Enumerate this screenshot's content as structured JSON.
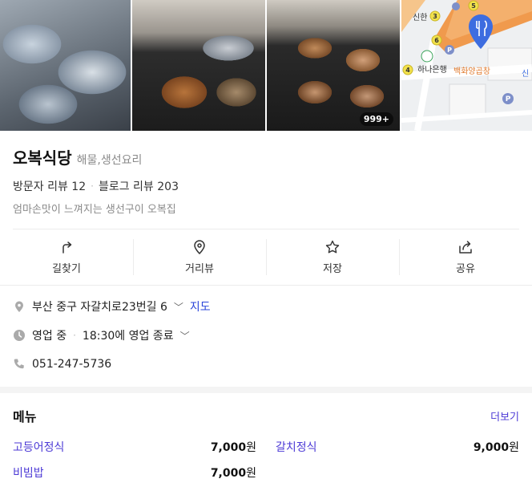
{
  "gallery": {
    "photo_count": "999+",
    "map_labels": {
      "bank_top": "신한",
      "bank_bottom": "하나은행",
      "store": "백화양곱창",
      "edge": "신",
      "numbers": [
        "3",
        "5",
        "6",
        "8",
        "4"
      ]
    }
  },
  "place": {
    "name": "오복식당",
    "category": "해물,생선요리",
    "visitor_reviews": "방문자 리뷰 12",
    "blog_reviews": "블로그 리뷰 203",
    "tagline": "엄마손맛이 느껴지는 생선구이 오복집"
  },
  "actions": [
    {
      "label": "길찾기",
      "icon": "directions-icon"
    },
    {
      "label": "거리뷰",
      "icon": "location-pin-icon"
    },
    {
      "label": "저장",
      "icon": "star-icon"
    },
    {
      "label": "공유",
      "icon": "share-icon"
    }
  ],
  "info": {
    "address": "부산 중구 자갈치로23번길 6",
    "map_link": "지도",
    "status": "영업 중",
    "hours": "18:30에 영업 종료",
    "phone": "051-247-5736"
  },
  "menu": {
    "title": "메뉴",
    "more_label": "더보기",
    "items": [
      {
        "name": "고등어정식",
        "price": "7,000",
        "unit": "원"
      },
      {
        "name": "갈치정식",
        "price": "9,000",
        "unit": "원"
      },
      {
        "name": "비빔밥",
        "price": "7,000",
        "unit": "원"
      }
    ]
  },
  "colors": {
    "accent": "#4c3ad6",
    "link": "#2a45d9",
    "map_pin": "#3d6de0",
    "muted": "#8a8a8a"
  }
}
